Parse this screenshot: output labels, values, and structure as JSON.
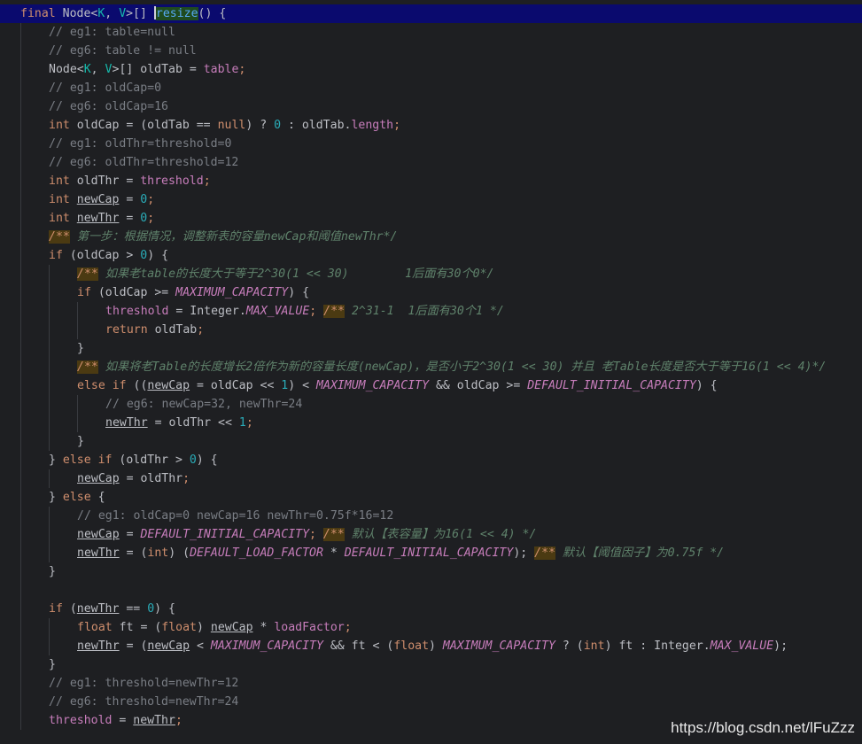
{
  "colors": {
    "background": "#1e1f22",
    "current_line": "#0a0a6e",
    "keyword": "#cf8e6d",
    "method": "#56a8f5",
    "field": "#c77dbb",
    "number": "#2aacb8",
    "comment": "#7a7e85",
    "doc_comment": "#5f826b",
    "text": "#bcbec4"
  },
  "editor": {
    "caret_line": 0,
    "lines": [
      {
        "indent": 0,
        "tokens": [
          {
            "t": "final ",
            "c": "kw"
          },
          {
            "t": "Node<",
            "c": "txt"
          },
          {
            "t": "K",
            "c": "gen"
          },
          {
            "t": ", ",
            "c": "txt"
          },
          {
            "t": "V",
            "c": "gen"
          },
          {
            "t": ">[] ",
            "c": "txt"
          },
          {
            "t": "CARET",
            "c": "caret"
          },
          {
            "t": "resize",
            "c": "fnh"
          },
          {
            "t": "() {",
            "c": "txt"
          }
        ]
      },
      {
        "indent": 1,
        "tokens": [
          {
            "t": "// eg1: table=null",
            "c": "cmt"
          }
        ]
      },
      {
        "indent": 1,
        "tokens": [
          {
            "t": "// eg6: table != null",
            "c": "cmt"
          }
        ]
      },
      {
        "indent": 1,
        "tokens": [
          {
            "t": "Node<",
            "c": "txt"
          },
          {
            "t": "K",
            "c": "gen"
          },
          {
            "t": ", ",
            "c": "txt"
          },
          {
            "t": "V",
            "c": "gen"
          },
          {
            "t": ">[] oldTab = ",
            "c": "txt"
          },
          {
            "t": "table",
            "c": "field"
          },
          {
            "t": ";",
            "c": "kw"
          }
        ]
      },
      {
        "indent": 1,
        "tokens": [
          {
            "t": "// eg1: oldCap=0",
            "c": "cmt"
          }
        ]
      },
      {
        "indent": 1,
        "tokens": [
          {
            "t": "// eg6: oldCap=16",
            "c": "cmt"
          }
        ]
      },
      {
        "indent": 1,
        "tokens": [
          {
            "t": "int ",
            "c": "kw"
          },
          {
            "t": "oldCap = (oldTab == ",
            "c": "txt"
          },
          {
            "t": "null",
            "c": "kw"
          },
          {
            "t": ") ? ",
            "c": "txt"
          },
          {
            "t": "0",
            "c": "num"
          },
          {
            "t": " : oldTab.",
            "c": "txt"
          },
          {
            "t": "length",
            "c": "field"
          },
          {
            "t": ";",
            "c": "kw"
          }
        ]
      },
      {
        "indent": 1,
        "tokens": [
          {
            "t": "// eg1: oldThr=threshold=0",
            "c": "cmt"
          }
        ]
      },
      {
        "indent": 1,
        "tokens": [
          {
            "t": "// eg6: oldThr=threshold=12",
            "c": "cmt"
          }
        ]
      },
      {
        "indent": 1,
        "tokens": [
          {
            "t": "int ",
            "c": "kw"
          },
          {
            "t": "oldThr = ",
            "c": "txt"
          },
          {
            "t": "threshold",
            "c": "field"
          },
          {
            "t": ";",
            "c": "kw"
          }
        ]
      },
      {
        "indent": 1,
        "tokens": [
          {
            "t": "int ",
            "c": "kw"
          },
          {
            "t": "newCap",
            "c": "local"
          },
          {
            "t": " = ",
            "c": "txt"
          },
          {
            "t": "0",
            "c": "num"
          },
          {
            "t": ";",
            "c": "kw"
          }
        ]
      },
      {
        "indent": 1,
        "tokens": [
          {
            "t": "int ",
            "c": "kw"
          },
          {
            "t": "newThr",
            "c": "local"
          },
          {
            "t": " = ",
            "c": "txt"
          },
          {
            "t": "0",
            "c": "num"
          },
          {
            "t": ";",
            "c": "kw"
          }
        ]
      },
      {
        "indent": 1,
        "tokens": [
          {
            "t": "/**",
            "c": "doct"
          },
          {
            "t": " 第一步：根据情况，调整新表的容量newCap和阈值newThr*/",
            "c": "doc"
          }
        ]
      },
      {
        "indent": 1,
        "tokens": [
          {
            "t": "if ",
            "c": "kw"
          },
          {
            "t": "(oldCap > ",
            "c": "txt"
          },
          {
            "t": "0",
            "c": "num"
          },
          {
            "t": ") {",
            "c": "txt"
          }
        ]
      },
      {
        "indent": 2,
        "tokens": [
          {
            "t": "/**",
            "c": "doct"
          },
          {
            "t": " 如果老table的长度大于等于2^30(1 << 30)        1后面有30个0*/",
            "c": "doc"
          }
        ]
      },
      {
        "indent": 2,
        "tokens": [
          {
            "t": "if ",
            "c": "kw"
          },
          {
            "t": "(oldCap >= ",
            "c": "txt"
          },
          {
            "t": "MAXIMUM_CAPACITY",
            "c": "const"
          },
          {
            "t": ") {",
            "c": "txt"
          }
        ]
      },
      {
        "indent": 3,
        "tokens": [
          {
            "t": "threshold",
            "c": "field"
          },
          {
            "t": " = Integer.",
            "c": "txt"
          },
          {
            "t": "MAX_VALUE",
            "c": "const"
          },
          {
            "t": "; ",
            "c": "kw"
          },
          {
            "t": "/**",
            "c": "doct"
          },
          {
            "t": " 2^31-1  1后面有30个1 */",
            "c": "doc"
          }
        ]
      },
      {
        "indent": 3,
        "tokens": [
          {
            "t": "return ",
            "c": "kw"
          },
          {
            "t": "oldTab",
            "c": "txt"
          },
          {
            "t": ";",
            "c": "kw"
          }
        ]
      },
      {
        "indent": 2,
        "tokens": [
          {
            "t": "}",
            "c": "txt"
          }
        ]
      },
      {
        "indent": 2,
        "tokens": [
          {
            "t": "/**",
            "c": "doct"
          },
          {
            "t": " 如果将老Table的长度增长2倍作为新的容量长度(newCap)，是否小于2^30(1 << 30) 并且 老Table长度是否大于等于16(1 << 4)*/",
            "c": "doc"
          }
        ]
      },
      {
        "indent": 2,
        "tokens": [
          {
            "t": "else if ",
            "c": "kw"
          },
          {
            "t": "((",
            "c": "txt"
          },
          {
            "t": "newCap",
            "c": "local"
          },
          {
            "t": " = oldCap << ",
            "c": "txt"
          },
          {
            "t": "1",
            "c": "num"
          },
          {
            "t": ") < ",
            "c": "txt"
          },
          {
            "t": "MAXIMUM_CAPACITY",
            "c": "const"
          },
          {
            "t": " && oldCap >= ",
            "c": "txt"
          },
          {
            "t": "DEFAULT_INITIAL_CAPACITY",
            "c": "const"
          },
          {
            "t": ") {",
            "c": "txt"
          }
        ]
      },
      {
        "indent": 3,
        "tokens": [
          {
            "t": "// eg6: newCap=32, newThr=24",
            "c": "ucmt"
          }
        ]
      },
      {
        "indent": 3,
        "tokens": [
          {
            "t": "newThr",
            "c": "local"
          },
          {
            "t": " = oldThr << ",
            "c": "txt"
          },
          {
            "t": "1",
            "c": "num"
          },
          {
            "t": ";",
            "c": "kw"
          }
        ]
      },
      {
        "indent": 2,
        "tokens": [
          {
            "t": "}",
            "c": "txt"
          }
        ]
      },
      {
        "indent": 1,
        "tokens": [
          {
            "t": "} ",
            "c": "txt"
          },
          {
            "t": "else if ",
            "c": "kw"
          },
          {
            "t": "(oldThr > ",
            "c": "txt"
          },
          {
            "t": "0",
            "c": "num"
          },
          {
            "t": ") {",
            "c": "txt"
          }
        ]
      },
      {
        "indent": 2,
        "tokens": [
          {
            "t": "newCap",
            "c": "local"
          },
          {
            "t": " = oldThr",
            "c": "txt"
          },
          {
            "t": ";",
            "c": "kw"
          }
        ]
      },
      {
        "indent": 1,
        "tokens": [
          {
            "t": "} ",
            "c": "txt"
          },
          {
            "t": "else ",
            "c": "kw"
          },
          {
            "t": "{",
            "c": "txt"
          }
        ]
      },
      {
        "indent": 2,
        "tokens": [
          {
            "t": "// eg1: oldCap=0 newCap=16 newThr=0.75f*16=12",
            "c": "ucmt"
          }
        ]
      },
      {
        "indent": 2,
        "tokens": [
          {
            "t": "newCap",
            "c": "local"
          },
          {
            "t": " = ",
            "c": "txt"
          },
          {
            "t": "DEFAULT_INITIAL_CAPACITY",
            "c": "const"
          },
          {
            "t": "; ",
            "c": "kw"
          },
          {
            "t": "/**",
            "c": "doct"
          },
          {
            "t": " 默认【表容量】为16(1 << 4) */",
            "c": "doc"
          }
        ]
      },
      {
        "indent": 2,
        "tokens": [
          {
            "t": "newThr",
            "c": "local"
          },
          {
            "t": " = (",
            "c": "txt"
          },
          {
            "t": "int",
            "c": "kw"
          },
          {
            "t": ") (",
            "c": "txt"
          },
          {
            "t": "DEFAULT_LOAD_FACTOR",
            "c": "const"
          },
          {
            "t": " * ",
            "c": "txt"
          },
          {
            "t": "DEFAULT_INITIAL_CAPACITY",
            "c": "const"
          },
          {
            "t": "); ",
            "c": "txt"
          },
          {
            "t": "/**",
            "c": "doct"
          },
          {
            "t": " 默认【阈值因子】为0.75f */",
            "c": "doc"
          }
        ]
      },
      {
        "indent": 1,
        "tokens": [
          {
            "t": "}",
            "c": "txt"
          }
        ]
      },
      {
        "indent": 0,
        "tokens": []
      },
      {
        "indent": 1,
        "tokens": [
          {
            "t": "if ",
            "c": "kw"
          },
          {
            "t": "(",
            "c": "txt"
          },
          {
            "t": "newThr",
            "c": "local"
          },
          {
            "t": " == ",
            "c": "txt"
          },
          {
            "t": "0",
            "c": "num"
          },
          {
            "t": ") {",
            "c": "txt"
          }
        ]
      },
      {
        "indent": 2,
        "tokens": [
          {
            "t": "float ",
            "c": "kw"
          },
          {
            "t": "ft = (",
            "c": "txt"
          },
          {
            "t": "float",
            "c": "kw"
          },
          {
            "t": ") ",
            "c": "txt"
          },
          {
            "t": "newCap",
            "c": "local"
          },
          {
            "t": " * ",
            "c": "txt"
          },
          {
            "t": "loadFactor",
            "c": "field"
          },
          {
            "t": ";",
            "c": "kw"
          }
        ]
      },
      {
        "indent": 2,
        "tokens": [
          {
            "t": "newThr",
            "c": "local"
          },
          {
            "t": " = (",
            "c": "txt"
          },
          {
            "t": "newCap",
            "c": "local"
          },
          {
            "t": " < ",
            "c": "txt"
          },
          {
            "t": "MAXIMUM_CAPACITY",
            "c": "const"
          },
          {
            "t": " && ft < (",
            "c": "txt"
          },
          {
            "t": "float",
            "c": "kw"
          },
          {
            "t": ") ",
            "c": "txt"
          },
          {
            "t": "MAXIMUM_CAPACITY",
            "c": "const"
          },
          {
            "t": " ? (",
            "c": "txt"
          },
          {
            "t": "int",
            "c": "kw"
          },
          {
            "t": ") ft : Integer.",
            "c": "txt"
          },
          {
            "t": "MAX_VALUE",
            "c": "const"
          },
          {
            "t": ");",
            "c": "txt"
          }
        ]
      },
      {
        "indent": 1,
        "tokens": [
          {
            "t": "}",
            "c": "txt"
          }
        ]
      },
      {
        "indent": 1,
        "tokens": [
          {
            "t": "// eg1: threshold=newThr=12",
            "c": "ucmt"
          }
        ]
      },
      {
        "indent": 1,
        "tokens": [
          {
            "t": "// eg6: threshold=newThr=24",
            "c": "ucmt"
          }
        ]
      },
      {
        "indent": 1,
        "tokens": [
          {
            "t": "threshold",
            "c": "field"
          },
          {
            "t": " = ",
            "c": "txt"
          },
          {
            "t": "newThr",
            "c": "local"
          },
          {
            "t": ";",
            "c": "kw"
          }
        ]
      }
    ]
  },
  "watermark": {
    "text": "https://blog.csdn.net/lFuZzz"
  }
}
